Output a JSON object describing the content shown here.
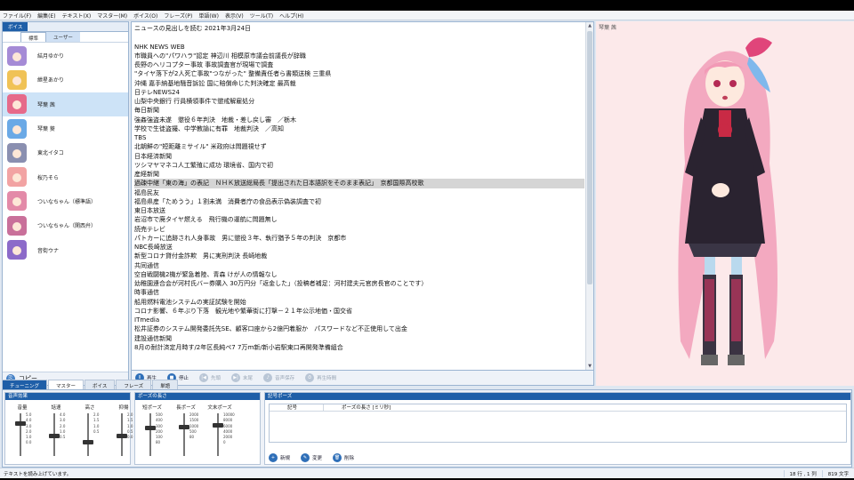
{
  "menu": [
    "ファイル(F)",
    "編集(E)",
    "テキスト(X)",
    "マスター(M)",
    "ボイス(O)",
    "フレーズ(P)",
    "単語(W)",
    "表示(V)",
    "ツール(T)",
    "ヘルプ(H)"
  ],
  "char_pane": {
    "tab_voice": "ボイス",
    "sub_tabs": [
      "標準",
      "ユーザー"
    ],
    "characters": [
      {
        "name": "結月ゆかり",
        "color": "#a58bd6"
      },
      {
        "name": "紲星あかり",
        "color": "#f0c256"
      },
      {
        "name": "琴葉 茜",
        "color": "#e66a8a"
      },
      {
        "name": "琴葉 葵",
        "color": "#6aa9e6"
      },
      {
        "name": "東北イタコ",
        "color": "#8a8fb0"
      },
      {
        "name": "桜乃そら",
        "color": "#f2a3a3"
      },
      {
        "name": "ついなちゃん（標準語）",
        "color": "#e38aa8"
      },
      {
        "name": "ついなちゃん（関西弁）",
        "color": "#c9709a"
      },
      {
        "name": "音街ウナ",
        "color": "#8c6ac9"
      }
    ],
    "copy_label": "コピー"
  },
  "editor": {
    "lines": [
      "ニュースの見出しを読む 2021年3月24日",
      "",
      "NHK NEWS WEB",
      "市職員への\"パワハラ\"認定 神辺川 相模原市議会前議長が辞職",
      "長野のヘリコプター事故 事故調査官が現場で調査",
      "\"タイヤ落下が2人死亡事故\"つながった\" 整備責任者ら書類送検 三重県",
      "沖縄 嘉手納基地騒音訴訟 国に賠償命じた判決確定 最高裁",
      "日テレNEWS24",
      "山梨中央銀行 行員横領事件で懲戒解雇処分",
      "毎日新聞",
      "強姦強盗未遂　懲役６年判決　地裁・差し戻し審　／栃木",
      "学校で生徒盗撮、中学教諭に有罪　地裁判決　／高知",
      "TBS",
      "北朝鮮の\"短距離ミサイル\" 米政府は問題視せず",
      "日本経済新聞",
      "ツシマヤマネコ人工繁殖に成功 環境省、国内で初",
      "産経新聞",
      "過疎中継「東の海」の表記　ＮＨＫ放送総局長「提出された日本語訳をそのまま表記」　京都国際高校歌",
      "福島民友",
      "福島県産「ためうう」１割未満　消費者庁の食品表示偽装調査で初",
      "東日本放送",
      "岩沼市で廃タイヤ燃える　飛行機の運航に問題無し",
      "読売テレビ",
      "パトカーに追跡され人身事故　男に懲役３年、執行猶予５年の判決　京都市",
      "NBC長崎放送",
      "新型コロナ貸付金詐欺　男に実刑判決 長崎地裁",
      "共同通信",
      "空自戦闘機2機が緊急着陸、青森 けが人の情報なし",
      "幼稚園連合会が河村氏バー券購入 30万円分「返金した」（投稿者補足：河村建夫元官房長官のことです）",
      "時事通信",
      "船用燃料電池システムの実証試験を開始",
      "コロナ影響、６年ぶり下落　観光地や繁華街に打撃－２１年公示地価・国交省",
      "ITmedia",
      "松井証券のシステム開発委託先SE、顧客口座から2億円着服か　パスワードなど不正使用して出金",
      "建設通信新聞",
      "8月の耐計済定月時す/2年区長純ペ7 7万ｍ新/新小岩駅東口再開発準備組合"
    ],
    "highlight_index": 17
  },
  "playbar": [
    {
      "icon": "II",
      "label": "再生",
      "disabled": false
    },
    {
      "icon": "■",
      "label": "停止",
      "disabled": false
    },
    {
      "icon": "|◀",
      "label": "先頭",
      "disabled": true
    },
    {
      "icon": "▶|",
      "label": "末尾",
      "disabled": true
    },
    {
      "icon": "♪",
      "label": "音声保存",
      "disabled": true
    },
    {
      "icon": "⏱",
      "label": "再生時間",
      "disabled": true
    }
  ],
  "image_pane": {
    "name": "琴葉 茜"
  },
  "tuning": {
    "tabs": [
      "チューニング",
      "マスター",
      "ボイス",
      "フレーズ",
      "単語"
    ],
    "effects_title": "音声効果",
    "pause_title": "ポーズの長さ",
    "effects": [
      {
        "label": "音量",
        "ticks": [
          "5.0",
          "4.0",
          "3.0",
          "2.0",
          "1.0",
          "0.0"
        ],
        "value": 0.8
      },
      {
        "label": "話速",
        "ticks": [
          "4.0",
          "3.0",
          "2.0",
          "1.0",
          "0.5"
        ],
        "value": 0.5
      },
      {
        "label": "高さ",
        "ticks": [
          "2.0",
          "1.5",
          "1.0",
          "0.5"
        ],
        "value": 0.33
      },
      {
        "label": "抑揚",
        "ticks": [
          "2.0",
          "1.5",
          "1.0",
          "0.5",
          "0.0"
        ],
        "value": 0.5
      }
    ],
    "pauses": [
      {
        "label": "短ポーズ",
        "ticks": [
          "500",
          "400",
          "300",
          "200",
          "100",
          "80"
        ],
        "value": 0.7
      },
      {
        "label": "長ポーズ",
        "ticks": [
          "2000",
          "1500",
          "1000",
          "500",
          "80"
        ],
        "value": 0.72
      },
      {
        "label": "文末ポーズ",
        "ticks": [
          "10000",
          "8000",
          "6000",
          "4000",
          "2000",
          "0"
        ],
        "value": 0.75
      }
    ],
    "symbol_pause": {
      "title": "記号ポーズ",
      "columns": [
        "記号",
        "ポーズの長さ [ミリ秒]"
      ],
      "buttons": [
        "新規",
        "変更",
        "削除"
      ]
    }
  },
  "status": {
    "message": "テキストを読み上げています。",
    "position": "18 行 , 1 列",
    "count": "819 文字"
  }
}
